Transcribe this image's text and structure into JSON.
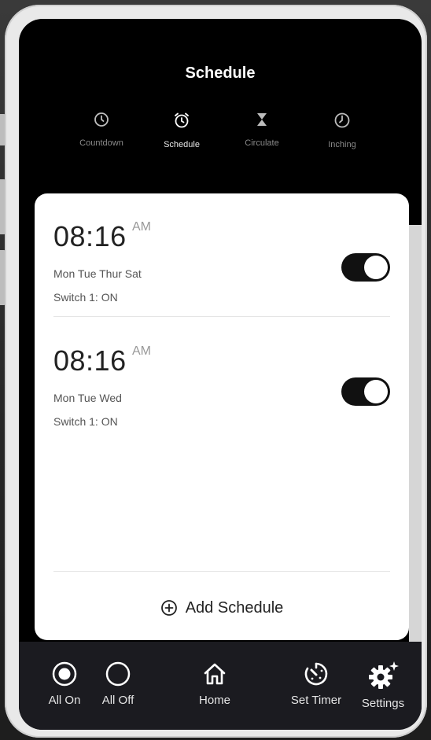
{
  "header": {
    "title": "Schedule"
  },
  "tabs": [
    {
      "label": "Countdown",
      "icon": "clock-icon",
      "active": false
    },
    {
      "label": "Schedule",
      "icon": "alarm-clock-icon",
      "active": true
    },
    {
      "label": "Circulate",
      "icon": "hourglass-icon",
      "active": false
    },
    {
      "label": "Inching",
      "icon": "timer-icon",
      "active": false
    }
  ],
  "schedules": [
    {
      "time": "08:16",
      "ampm": "AM",
      "days": "Mon Tue Thur Sat",
      "action": "Switch 1: ON",
      "enabled": true
    },
    {
      "time": "08:16",
      "ampm": "AM",
      "days": "Mon Tue Wed",
      "action": "Switch 1: ON",
      "enabled": true
    }
  ],
  "add_button": {
    "label": "Add Schedule",
    "icon": "plus-circle-icon"
  },
  "bottom_nav": [
    {
      "label": "All On",
      "icon": "radio-on-icon"
    },
    {
      "label": "All Off",
      "icon": "radio-off-icon"
    },
    {
      "label": "Home",
      "icon": "home-icon"
    },
    {
      "label": "Set Timer",
      "icon": "timer-dial-icon"
    },
    {
      "label": "Settings",
      "icon": "gear-sparkle-icon"
    }
  ],
  "colors": {
    "toggle_on": "#111111",
    "card": "#ffffff",
    "header_bg": "#000000",
    "bottom_bar": "#1b1b20"
  }
}
